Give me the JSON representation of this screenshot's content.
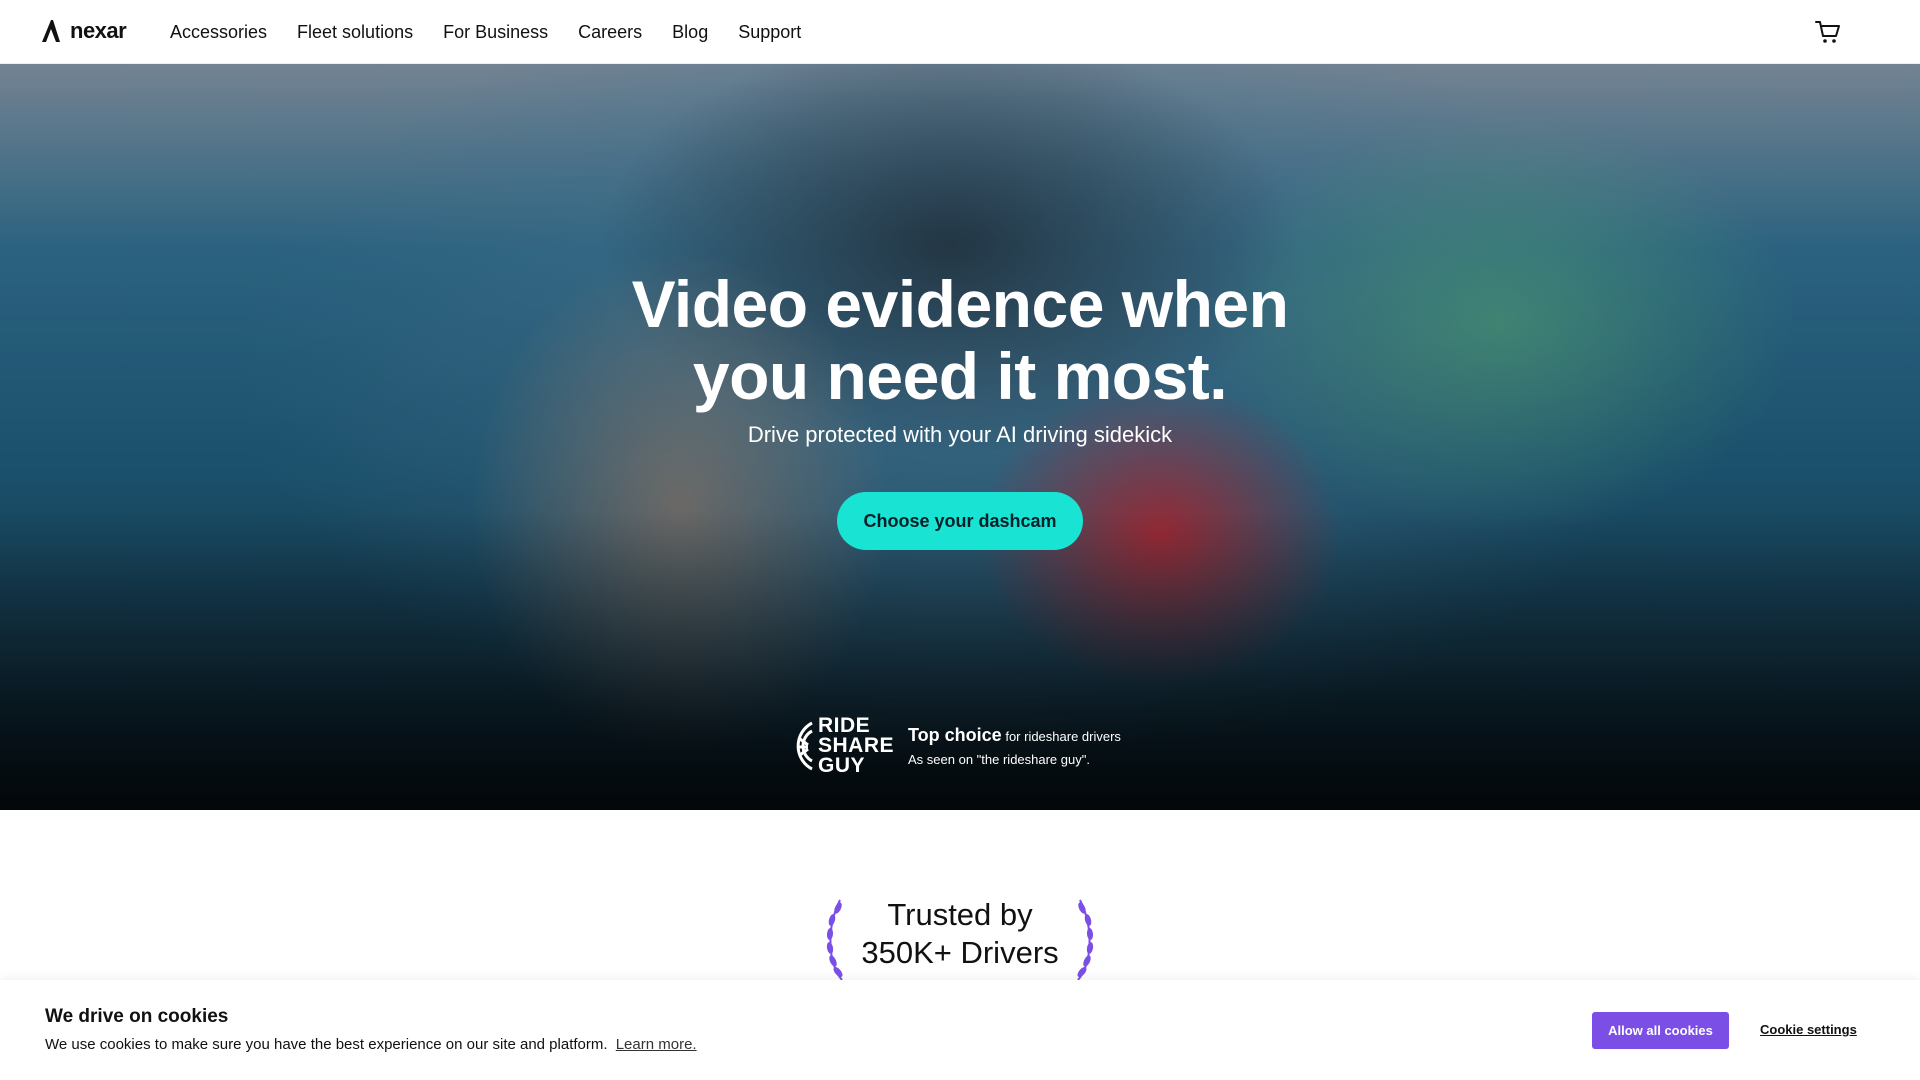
{
  "nav": {
    "logo_text": "nexar",
    "items": [
      {
        "label": "Accessories"
      },
      {
        "label": "Fleet solutions"
      },
      {
        "label": "For Business"
      },
      {
        "label": "Careers"
      },
      {
        "label": "Blog"
      },
      {
        "label": "Support"
      }
    ],
    "cart_icon": "cart-icon"
  },
  "hero": {
    "title_line1": "Video evidence when",
    "title_line2": "you need it most.",
    "subtitle": "Drive protected with your AI driving sidekick",
    "cta_label": "Choose your dashcam",
    "badge": {
      "logo_lines": [
        "RIDE",
        "SHARE",
        "GUY"
      ],
      "strong": "Top choice",
      "suffix": "for rideshare drivers",
      "line2": "As seen on \"the rideshare guy\"."
    }
  },
  "trusted": {
    "line1": "Trusted by",
    "line2": "350K+ Drivers",
    "accent_color": "#7b4fe6"
  },
  "cookie": {
    "title": "We drive on cookies",
    "body": "We use cookies to make sure you have the best experience on our site and platform.",
    "learn_more": "Learn more.",
    "allow_label": "Allow all cookies",
    "settings_label": "Cookie settings"
  },
  "colors": {
    "cta": "#19e3d3",
    "allow_button": "#7b4fe6"
  }
}
